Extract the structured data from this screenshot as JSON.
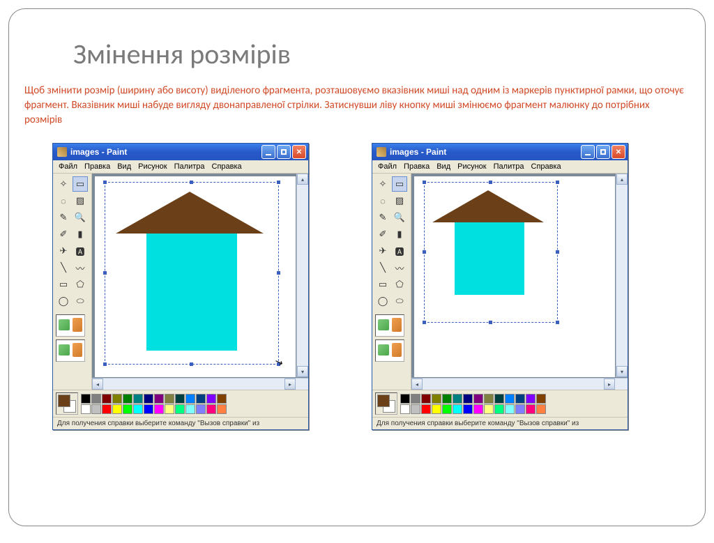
{
  "title": "Змінення розмірів",
  "description": "Щоб змінити розмір (ширину або висоту) виділеного фрагмента, розташовуємо вказівник миші  над одним із маркерів пунктирної рамки, що оточує фрагмент. Вказівник миші набуде вигляду двонаправленої стрілки. Затиснувши ліву кнопку миші змінюємо фрагмент малюнку до потрібних розмірів",
  "paint": {
    "window_title": "images - Paint",
    "menus": [
      "Файл",
      "Правка",
      "Вид",
      "Рисунок",
      "Палитра",
      "Справка"
    ],
    "status": "Для получения справки выберите команду \"Вызов справки\" из",
    "palette_row1": [
      "#000000",
      "#808080",
      "#800000",
      "#808000",
      "#008000",
      "#008080",
      "#000080",
      "#800080",
      "#808040",
      "#004040",
      "#0080ff",
      "#004080",
      "#8000ff",
      "#804000"
    ],
    "palette_row2": [
      "#ffffff",
      "#c0c0c0",
      "#ff0000",
      "#ffff00",
      "#00ff00",
      "#00ffff",
      "#0000ff",
      "#ff00ff",
      "#ffff80",
      "#00ff80",
      "#80ffff",
      "#8080ff",
      "#ff0080",
      "#ff8040"
    ],
    "fg_color": "#6b4018",
    "bg_color": "#ffffff"
  },
  "tool_glyphs": [
    "✧",
    "▭",
    "◌",
    "▨",
    "✎",
    "🔍",
    "✐",
    "▮",
    "✈",
    "🅰",
    "╲",
    "〰",
    "▭",
    "⬠",
    "◯",
    "⬭"
  ]
}
